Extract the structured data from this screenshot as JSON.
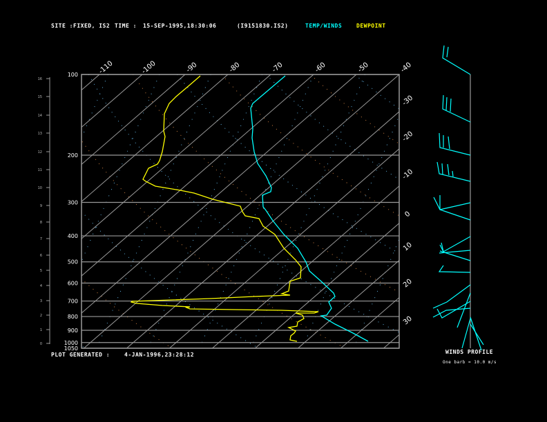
{
  "header": {
    "site_label": "SITE :",
    "site_value": "FIXED, IS2",
    "time_label": "TIME :",
    "time_value": "15-SEP-1995,18:30:06",
    "file": "(I9151830.IS2)",
    "legend_temp": "TEMP/WINDS",
    "legend_dew": "DEWPOINT"
  },
  "footer": {
    "generated_label": "PLOT GENERATED :",
    "generated_value": "4-JAN-1996,23:28:12",
    "winds_title": "WINDS PROFILE",
    "barb_note": "One barb = 10.0 m/s"
  },
  "colors": {
    "temp": "#00ffff",
    "dewpoint": "#ffff00",
    "grid": "#9a9a9a",
    "mixing": "#5fb0e0",
    "adiabat": "#d08040"
  },
  "chart_data": {
    "type": "line",
    "title": "Skew-T Log-P sounding",
    "pressure_ticks": [
      "100",
      "200",
      "300",
      "400",
      "500",
      "600",
      "700",
      "800",
      "900",
      "1000",
      "1050"
    ],
    "height_km_ticks": [
      "0",
      "1",
      "2",
      "3",
      "4",
      "5",
      "6",
      "7",
      "8",
      "9",
      "10",
      "11",
      "12",
      "13",
      "14",
      "15",
      "16"
    ],
    "top_temp_ticks": [
      "-110",
      "-100",
      "-90",
      "-80",
      "-70",
      "-60",
      "-50",
      "-40"
    ],
    "right_temp_ticks": [
      "-30",
      "-20",
      "-10",
      "0",
      "10",
      "20",
      "30"
    ],
    "series": [
      {
        "name": "TEMP/WINDS",
        "points_p_T": [
          [
            100,
            -70
          ],
          [
            130,
            -68
          ],
          [
            170,
            -62
          ],
          [
            200,
            -58
          ],
          [
            250,
            -50
          ],
          [
            300,
            -40
          ],
          [
            400,
            -25
          ],
          [
            500,
            -12
          ],
          [
            600,
            -2
          ],
          [
            700,
            10
          ],
          [
            800,
            14
          ],
          [
            900,
            22
          ],
          [
            1000,
            28
          ]
        ]
      },
      {
        "name": "DEWPOINT",
        "points_p_T": [
          [
            100,
            -88
          ],
          [
            150,
            -93
          ],
          [
            200,
            -95
          ],
          [
            230,
            -100
          ],
          [
            260,
            -95
          ],
          [
            300,
            -72
          ],
          [
            400,
            -45
          ],
          [
            500,
            -26
          ],
          [
            600,
            -15
          ],
          [
            700,
            -65
          ],
          [
            750,
            -40
          ],
          [
            800,
            8
          ],
          [
            850,
            5
          ],
          [
            900,
            4
          ],
          [
            1000,
            8
          ]
        ]
      }
    ]
  }
}
